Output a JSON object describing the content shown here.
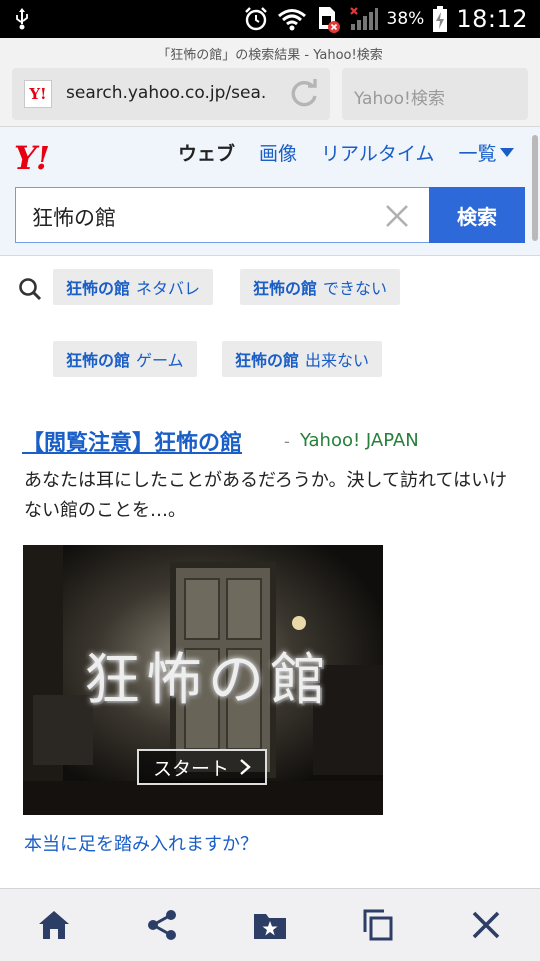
{
  "status_bar": {
    "battery": "38%",
    "time": "18:12"
  },
  "browser": {
    "page_title": "「狂怖の館」の検索結果 - Yahoo!検索",
    "url": "search.yahoo.co.jp/sea.",
    "search_placeholder": "Yahoo!検索",
    "favicon_text": "Y!"
  },
  "yahoo": {
    "logo": "Y!",
    "tabs": [
      {
        "label": "ウェブ",
        "active": true
      },
      {
        "label": "画像",
        "active": false
      },
      {
        "label": "リアルタイム",
        "active": false
      },
      {
        "label": "一覧",
        "active": false
      }
    ],
    "query": "狂怖の館",
    "search_button": "検索"
  },
  "suggestions": [
    {
      "bold": "狂怖の館",
      "rest": "ネタバレ"
    },
    {
      "bold": "狂怖の館",
      "rest": "できない"
    },
    {
      "bold": "狂怖の館",
      "rest": "ゲーム"
    },
    {
      "bold": "狂怖の館",
      "rest": "出来ない"
    }
  ],
  "result": {
    "title": "【閲覧注意】狂怖の館",
    "separator": "-",
    "site": "Yahoo! JAPAN",
    "description": "あなたは耳にしたことがあるだろうか。決して訪れてはいけない館のことを…。",
    "banner_title": "狂怖の館",
    "banner_button": "スタート",
    "link_text": "本当に足を踏み入れますか？"
  },
  "colors": {
    "yahoo_red": "#e60012",
    "link_blue": "#1a5ec7",
    "site_green": "#27803a",
    "search_button": "#2d69d8",
    "toolbar_icon": "#2c3e66"
  },
  "toolbar_icons": [
    "home-icon",
    "share-icon",
    "bookmark-folder-icon",
    "tabs-icon",
    "close-icon"
  ]
}
